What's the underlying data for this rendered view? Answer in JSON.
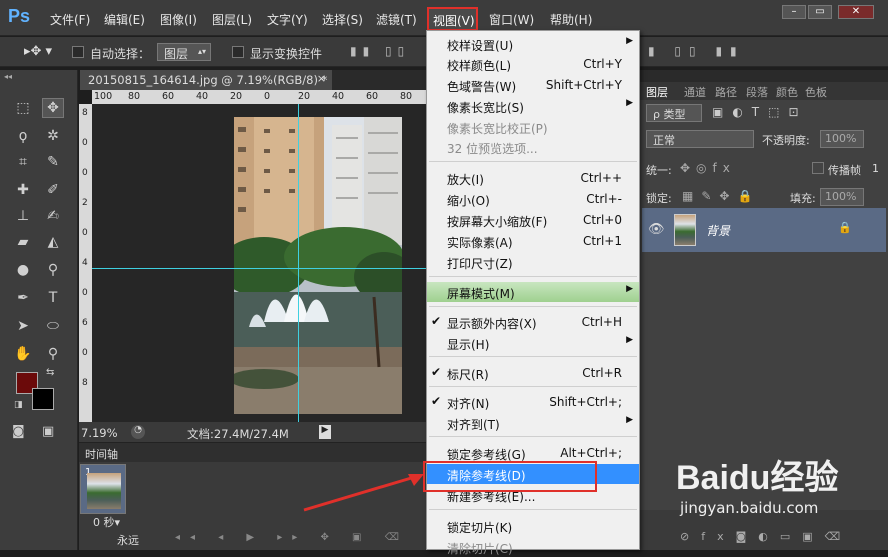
{
  "app": {
    "logo": "Ps"
  },
  "menubar": {
    "items": [
      "文件(F)",
      "编辑(E)",
      "图像(I)",
      "图层(L)",
      "文字(Y)",
      "选择(S)",
      "滤镜(T)",
      "视图(V)",
      "窗口(W)",
      "帮助(H)"
    ]
  },
  "window_controls": {
    "minimize": "–",
    "restore": "▭",
    "close": "✕"
  },
  "options_bar": {
    "auto_select_label": "自动选择：",
    "auto_select_value": "图层",
    "show_transform_label": "显示变换控件"
  },
  "document": {
    "tab_title": "20150815_164614.jpg @ 7.19%(RGB/8) *",
    "zoom": "7.19%",
    "doc_size": "文档:27.4M/27.4M",
    "ruler_h_ticks": [
      "100",
      "80",
      "60",
      "40",
      "20",
      "0",
      "20",
      "40",
      "60",
      "80",
      "100"
    ],
    "ruler_v_ticks": [
      "8",
      "0",
      "0",
      "2",
      "0",
      "4",
      "0",
      "6",
      "0",
      "8"
    ]
  },
  "timeline": {
    "header": "时间轴",
    "frame_number": "1",
    "frame_delay": "0 秒▾",
    "loop": "永远"
  },
  "layers_panel": {
    "tabs": [
      "图层",
      "通道",
      "路径",
      "段落",
      "颜色",
      "色板"
    ],
    "filter_label": "ρ 类型",
    "blend_mode": "正常",
    "opacity_label": "不透明度:",
    "opacity_value": "100%",
    "unify_label": "统一:",
    "propagate_label": "传播帧",
    "propagate_value": "1",
    "lock_label": "锁定:",
    "fill_label": "填充:",
    "fill_value": "100%",
    "layer_name": "背景"
  },
  "view_menu": {
    "items": [
      {
        "label": "校样设置(U)",
        "shortcut": "",
        "submenu": true
      },
      {
        "label": "校样颜色(L)",
        "shortcut": "Ctrl+Y"
      },
      {
        "label": "色域警告(W)",
        "shortcut": "Shift+Ctrl+Y"
      },
      {
        "label": "像素长宽比(S)",
        "shortcut": "",
        "submenu": true
      },
      {
        "label": "像素长宽比校正(P)",
        "shortcut": "",
        "disabled": true
      },
      {
        "label": "32 位预览选项...",
        "shortcut": "",
        "disabled": true
      },
      {
        "label": "放大(I)",
        "shortcut": "Ctrl++"
      },
      {
        "label": "缩小(O)",
        "shortcut": "Ctrl+-"
      },
      {
        "label": "按屏幕大小缩放(F)",
        "shortcut": "Ctrl+0"
      },
      {
        "label": "实际像素(A)",
        "shortcut": "Ctrl+1"
      },
      {
        "label": "打印尺寸(Z)",
        "shortcut": ""
      },
      {
        "label": "屏幕模式(M)",
        "shortcut": "",
        "submenu": true
      },
      {
        "label": "显示额外内容(X)",
        "shortcut": "Ctrl+H",
        "checked": true
      },
      {
        "label": "显示(H)",
        "shortcut": "",
        "submenu": true
      },
      {
        "label": "标尺(R)",
        "shortcut": "Ctrl+R",
        "checked": true
      },
      {
        "label": "对齐(N)",
        "shortcut": "Shift+Ctrl+;",
        "checked": true
      },
      {
        "label": "对齐到(T)",
        "shortcut": "",
        "submenu": true
      },
      {
        "label": "锁定参考线(G)",
        "shortcut": "Alt+Ctrl+;"
      },
      {
        "label": "清除参考线(D)",
        "shortcut": "",
        "highlighted": true
      },
      {
        "label": "新建参考线(E)...",
        "shortcut": ""
      },
      {
        "label": "锁定切片(K)",
        "shortcut": ""
      },
      {
        "label": "清除切片(C)",
        "shortcut": "",
        "disabled": true
      }
    ]
  },
  "watermark": {
    "brand": "Baidu经验",
    "url": "jingyan.baidu.com"
  },
  "colors": {
    "foreground": "#6b0a0a",
    "background": "#000000",
    "highlight": "#3390ff",
    "annotation": "#e0302a",
    "guide": "#3fd0e0"
  }
}
